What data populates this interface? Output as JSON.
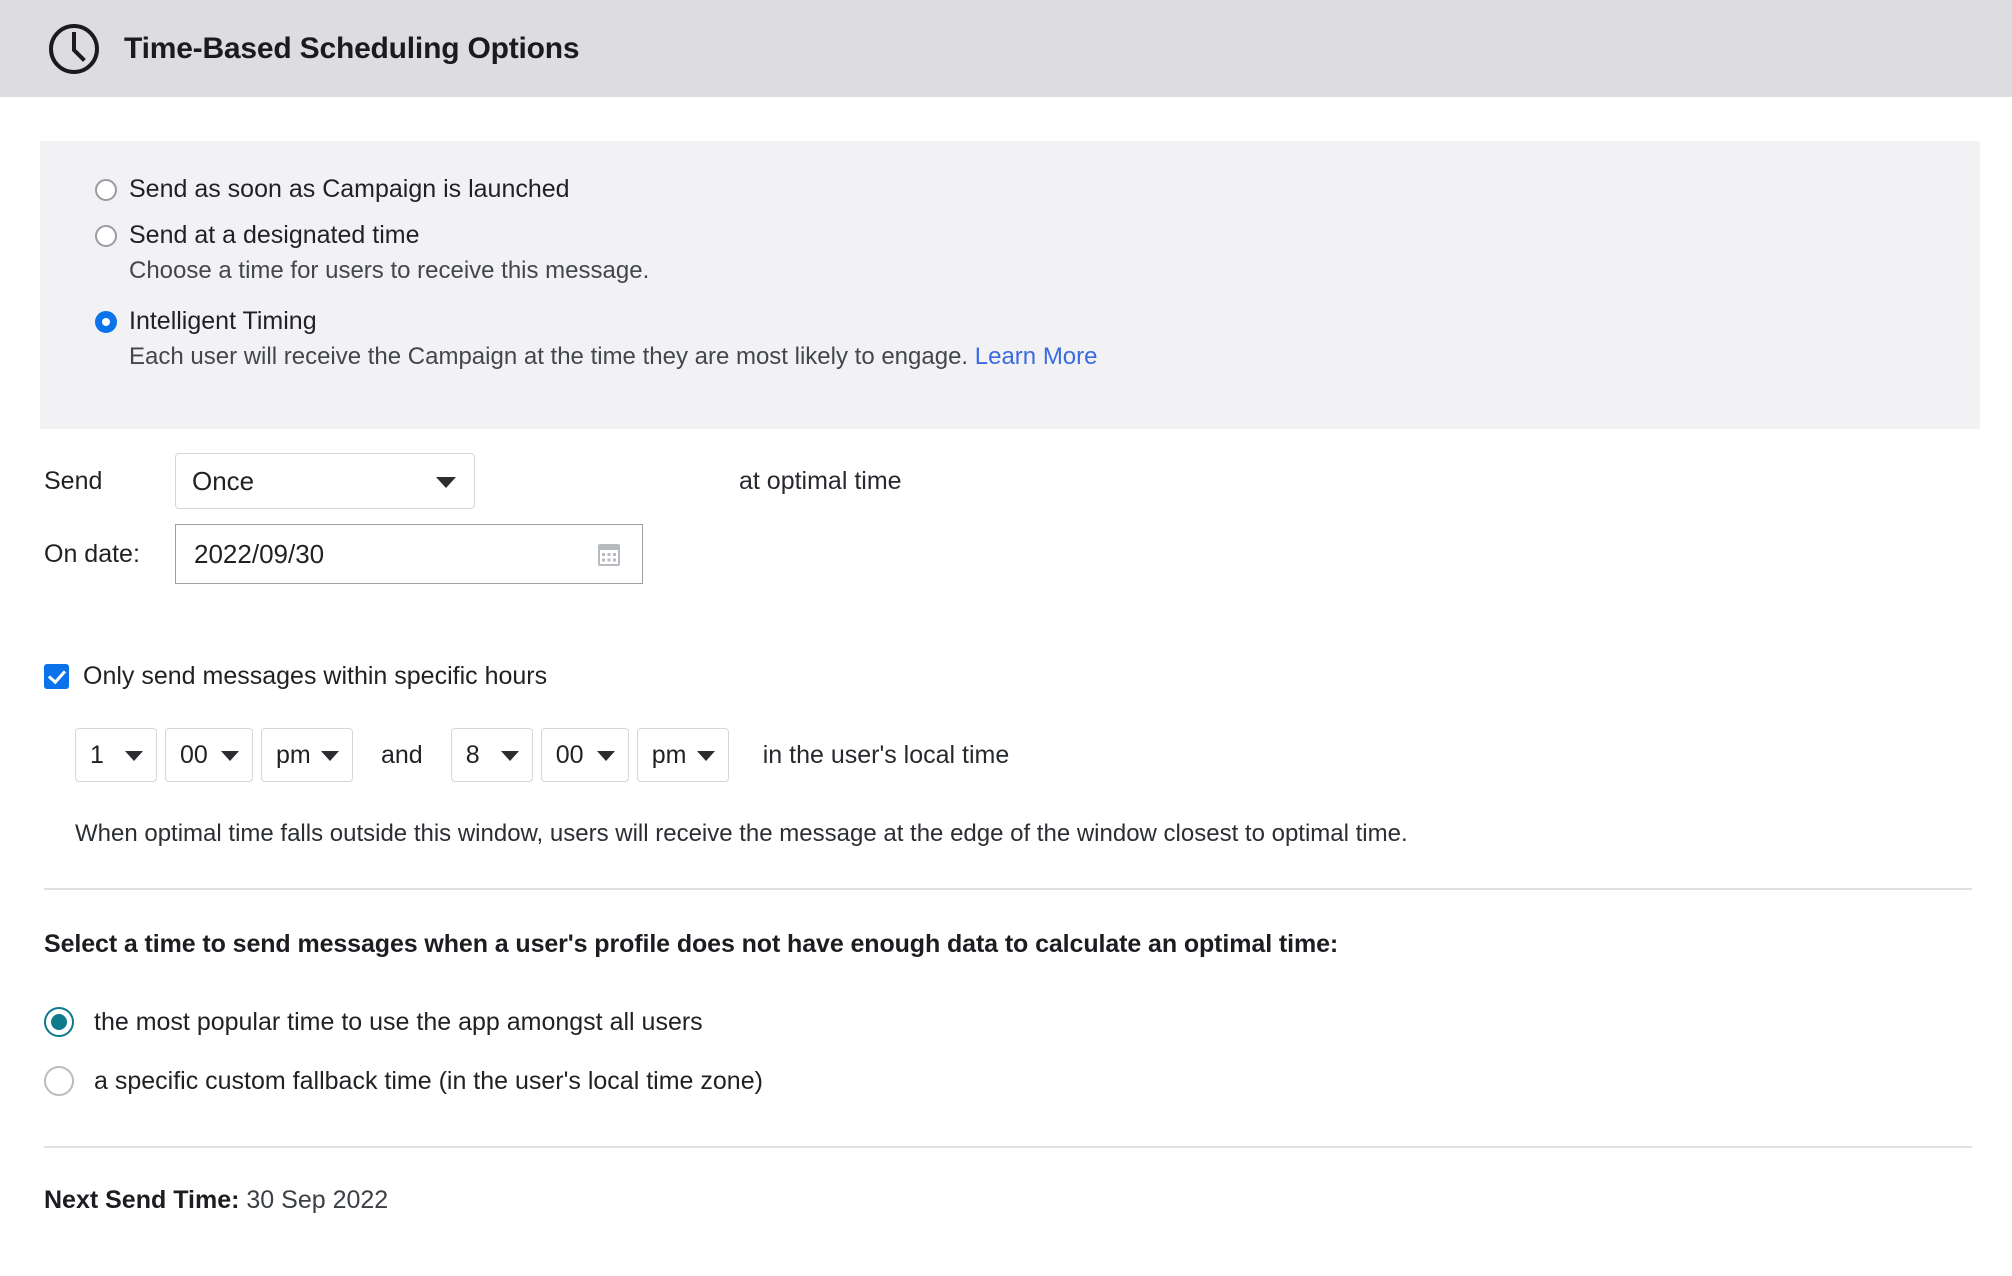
{
  "header": {
    "title": "Time-Based Scheduling Options",
    "icon": "clock-icon"
  },
  "schedule_options": {
    "selected": "intelligent_timing",
    "items": [
      {
        "id": "as_soon_as_launched",
        "label": "Send as soon as Campaign is launched",
        "sub": "",
        "checked": false
      },
      {
        "id": "designated_time",
        "label": "Send at a designated time",
        "sub": "Choose a time for users to receive this message.",
        "checked": false
      },
      {
        "id": "intelligent_timing",
        "label": "Intelligent Timing",
        "sub": "Each user will receive the Campaign at the time they are most likely to engage.",
        "link_label": "Learn More",
        "checked": true
      }
    ]
  },
  "send": {
    "label": "Send",
    "frequency_value": "Once",
    "suffix": "at optimal time"
  },
  "on_date": {
    "label": "On date:",
    "value": "2022/09/30",
    "icon": "calendar-icon"
  },
  "specific_hours": {
    "checkbox_label": "Only send messages within specific hours",
    "checked": true,
    "start_hour": "1",
    "start_minute": "00",
    "start_meridiem": "pm",
    "conjunction": "and",
    "end_hour": "8",
    "end_minute": "00",
    "end_meridiem": "pm",
    "timezone_note": "in the user's local time",
    "hint": "When optimal time falls outside this window, users will receive the message at the edge of the window closest to optimal time."
  },
  "fallback": {
    "title": "Select a time to send messages when a user's profile does not have enough data to calculate an optimal time:",
    "selected": "most_popular",
    "options": [
      {
        "id": "most_popular",
        "label": "the most popular time to use the app amongst all users",
        "checked": true
      },
      {
        "id": "custom_fallback",
        "label": "a specific custom fallback time (in the user's local time zone)",
        "checked": false
      }
    ]
  },
  "footer": {
    "next_send_label": "Next Send Time:",
    "next_send_value": "30 Sep 2022"
  },
  "colors": {
    "header_bg": "#dcdce1",
    "panel_bg": "#f2f2f4",
    "accent_blue": "#0b73ea",
    "accent_teal": "#0d7b8c",
    "link_blue": "#3b6be0"
  }
}
